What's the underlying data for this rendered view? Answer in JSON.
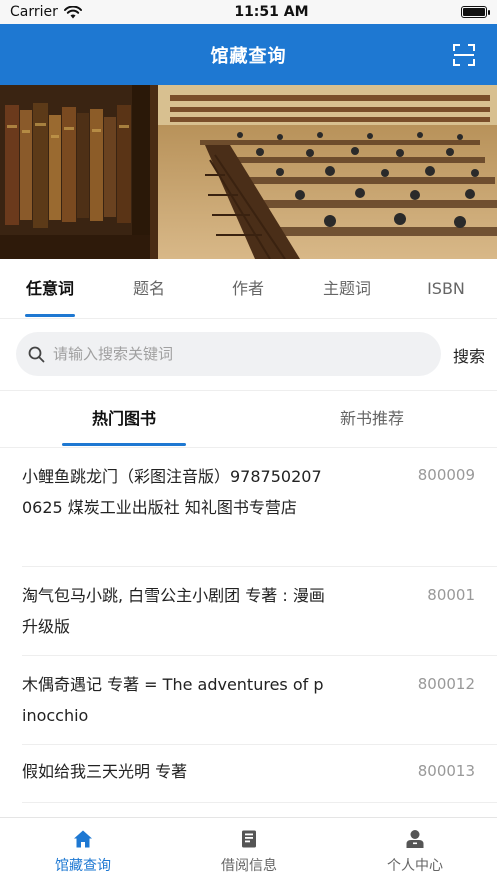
{
  "status_bar": {
    "carrier": "Carrier",
    "time": "11:51 AM"
  },
  "nav": {
    "title": "馆藏查询",
    "scan_icon": "scan-icon"
  },
  "search_tabs": [
    "任意词",
    "题名",
    "作者",
    "主题词",
    "ISBN"
  ],
  "search": {
    "placeholder": "请输入搜索关键词",
    "button_label": "搜索"
  },
  "list_tabs": [
    "热门图书",
    "新书推荐"
  ],
  "books": [
    {
      "title": "小鲤鱼跳龙门（彩图注音版）9787502070625 煤炭工业出版社 知礼图书专营店",
      "code": "800009"
    },
    {
      "title": "淘气包马小跳, 白雪公主小剧团 专著 : 漫画升级版",
      "code": "80001"
    },
    {
      "title": "木偶奇遇记 专著 = The adventures of pinocchio",
      "code": "800012"
    },
    {
      "title": "假如给我三天光明 专著",
      "code": "800013"
    }
  ],
  "bottom_tabs": [
    {
      "label": "馆藏查询",
      "icon": "home-icon"
    },
    {
      "label": "借阅信息",
      "icon": "book-icon"
    },
    {
      "label": "个人中心",
      "icon": "person-icon"
    }
  ],
  "colors": {
    "primary": "#1e78d2",
    "text_muted": "#999999"
  }
}
